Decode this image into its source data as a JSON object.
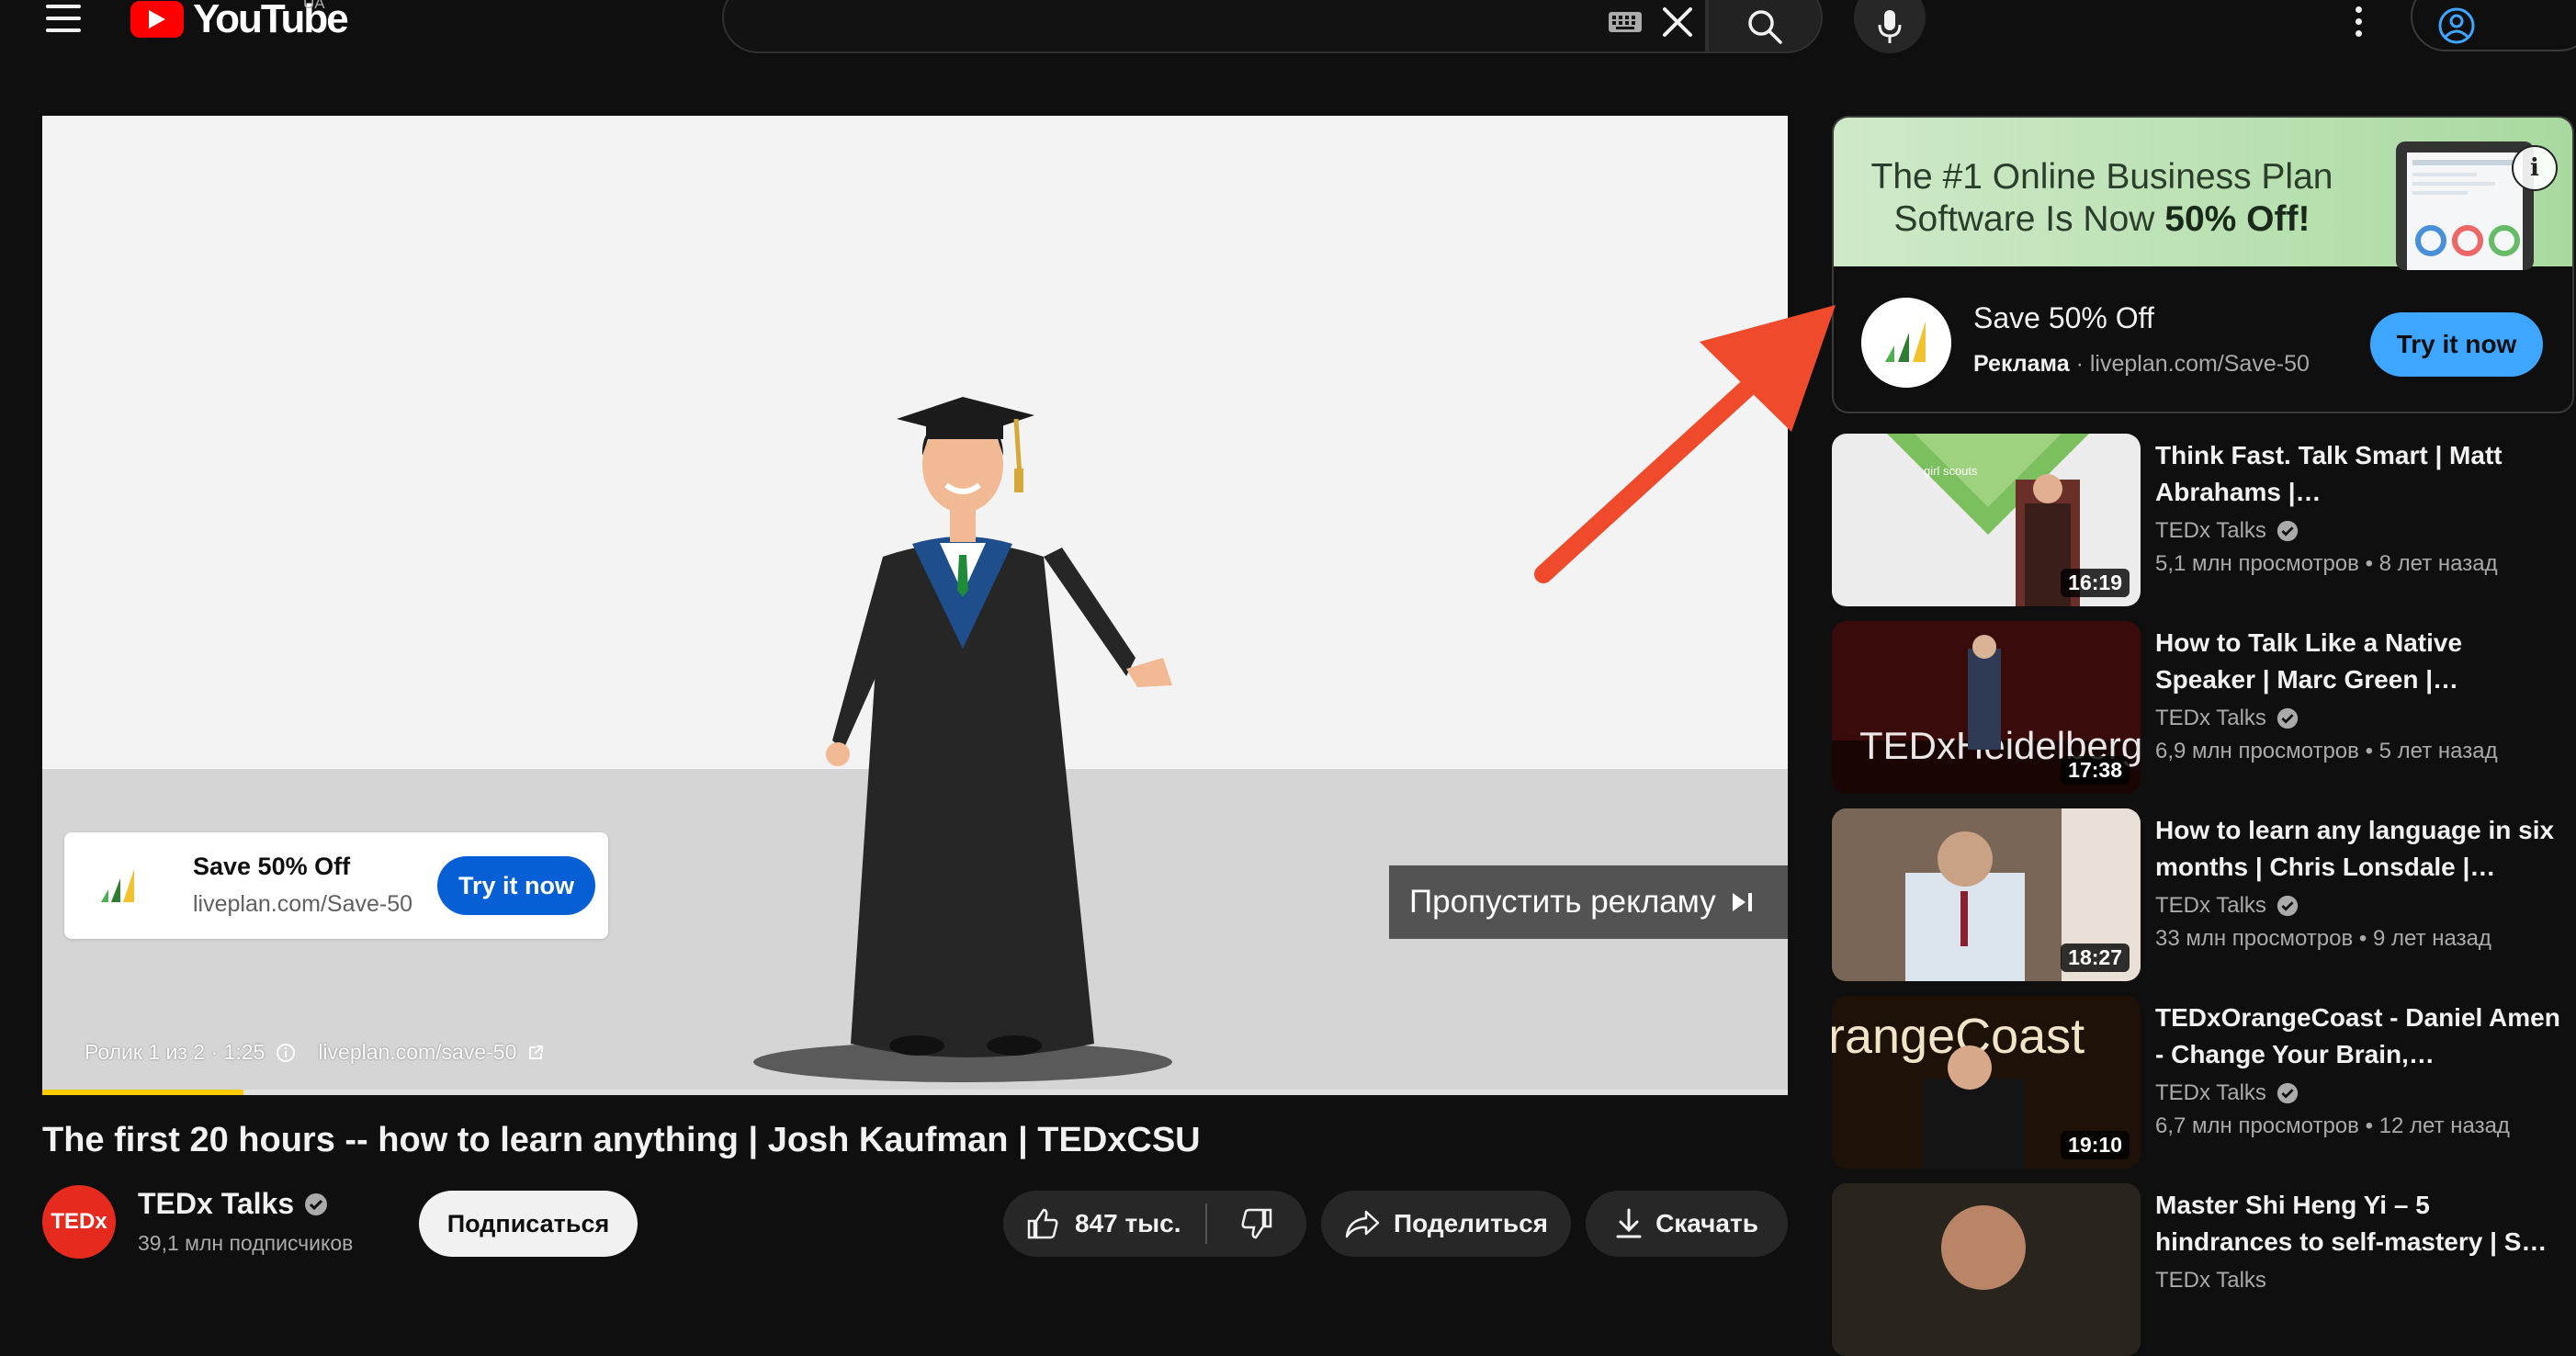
{
  "header": {
    "logo_text": "YouTube",
    "country": "UA",
    "search_value": ""
  },
  "player": {
    "ad_card": {
      "title": "Save 50% Off",
      "url": "liveplan.com/Save-50",
      "cta": "Try it now"
    },
    "skip_label": "Пропустить рекламу",
    "ad_counter": "Ролик 1 из 2 · 1:25",
    "ad_link": "liveplan.com/save-50",
    "progress": 0.115
  },
  "video": {
    "title": "The first 20 hours -- how to learn anything | Josh Kaufman | TEDxCSU",
    "channel": "TEDx Talks",
    "avatar_text": "TEDx",
    "subscribers": "39,1 млн подписчиков",
    "subscribe_label": "Подписаться",
    "likes": "847 тыс.",
    "share_label": "Поделиться",
    "download_label": "Скачать"
  },
  "sidebar_ad": {
    "headline_line1": "The #1 Online Business Plan",
    "headline_line2_prefix": "Software Is Now ",
    "headline_line2_bold": "50% Off!",
    "title": "Save 50% Off",
    "sponsored_label": "Реклама",
    "url": "liveplan.com/Save-50",
    "cta": "Try it now"
  },
  "related": [
    {
      "title": "Think Fast. Talk Smart | Matt Abrahams |…",
      "channel": "TEDx Talks",
      "views": "5,1 млн просмотров",
      "age": "8 лет назад",
      "duration": "16:19",
      "thumb_text": "girl scouts"
    },
    {
      "title": "How to Talk Like a Native Speaker | Marc Green |…",
      "channel": "TEDx Talks",
      "views": "6,9 млн просмотров",
      "age": "5 лет назад",
      "duration": "17:38",
      "thumb_text": "TEDxHeidelberg"
    },
    {
      "title": "How to learn any language in six months | Chris Lonsdale |…",
      "channel": "TEDx Talks",
      "views": "33 млн просмотров",
      "age": "9 лет назад",
      "duration": "18:27",
      "thumb_text": ""
    },
    {
      "title": "TEDxOrangeCoast - Daniel Amen - Change Your Brain,…",
      "channel": "TEDx Talks",
      "views": "6,7 млн просмотров",
      "age": "12 лет назад",
      "duration": "19:10",
      "thumb_text": "rangeCoast"
    },
    {
      "title": "Master Shi Heng Yi – 5 hindrances to self-mastery | S…",
      "channel": "TEDx Talks",
      "views": "",
      "age": "",
      "duration": "",
      "thumb_text": ""
    }
  ],
  "colors": {
    "brand_red": "#ff0000",
    "cta_blue": "#065fd4",
    "cta_light_blue": "#3ea6ff",
    "progress_yellow": "#ffcc00",
    "annotation_arrow": "#f04a2c"
  }
}
